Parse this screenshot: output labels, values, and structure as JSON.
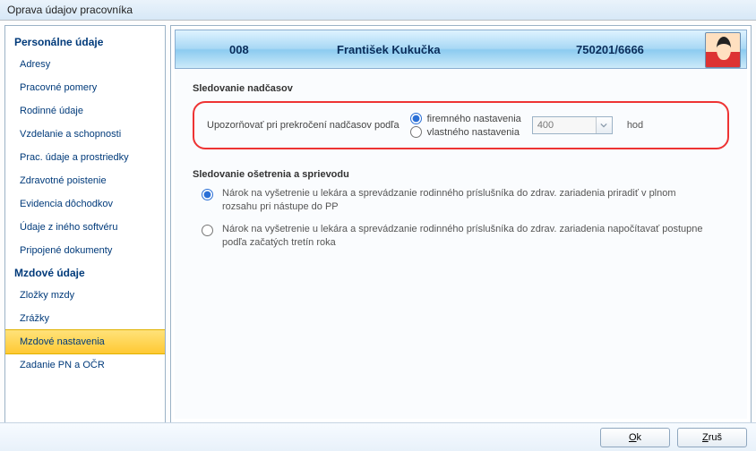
{
  "window": {
    "title": "Oprava údajov pracovníka"
  },
  "sidebar": {
    "head1": "Personálne údaje",
    "items1": [
      "Adresy",
      "Pracovné pomery",
      "Rodinné údaje",
      "Vzdelanie a schopnosti",
      "Prac. údaje a prostriedky",
      "Zdravotné poistenie",
      "Evidencia dôchodkov",
      "Údaje z iného softvéru",
      "Pripojené dokumenty"
    ],
    "head2": "Mzdové údaje",
    "items2": [
      "Zložky mzdy",
      "Zrážky",
      "Mzdové nastavenia",
      "Zadanie PN a OČR"
    ],
    "selected": "Mzdové nastavenia"
  },
  "header": {
    "code": "008",
    "name": "František Kukučka",
    "ident": "750201/6666"
  },
  "overtime": {
    "group": "Sledovanie nadčasov",
    "label": "Upozorňovať pri prekročení nadčasov podľa",
    "opt1": "firemného nastavenia",
    "opt2": "vlastného nastavenia",
    "value": "400",
    "unit": "hod"
  },
  "care": {
    "group": "Sledovanie ošetrenia a sprievodu",
    "opt1": "Nárok na vyšetrenie u lekára a sprevádzanie rodinného príslušníka do zdrav. zariadenia priradiť v plnom rozsahu pri nástupe do PP",
    "opt2": "Nárok na vyšetrenie u lekára a sprevádzanie rodinného príslušníka do zdrav. zariadenia napočítavať postupne podľa začatých tretín roka"
  },
  "buttons": {
    "ok_u": "O",
    "ok_rest": "k",
    "cancel_u": "Z",
    "cancel_rest": "ruš"
  }
}
